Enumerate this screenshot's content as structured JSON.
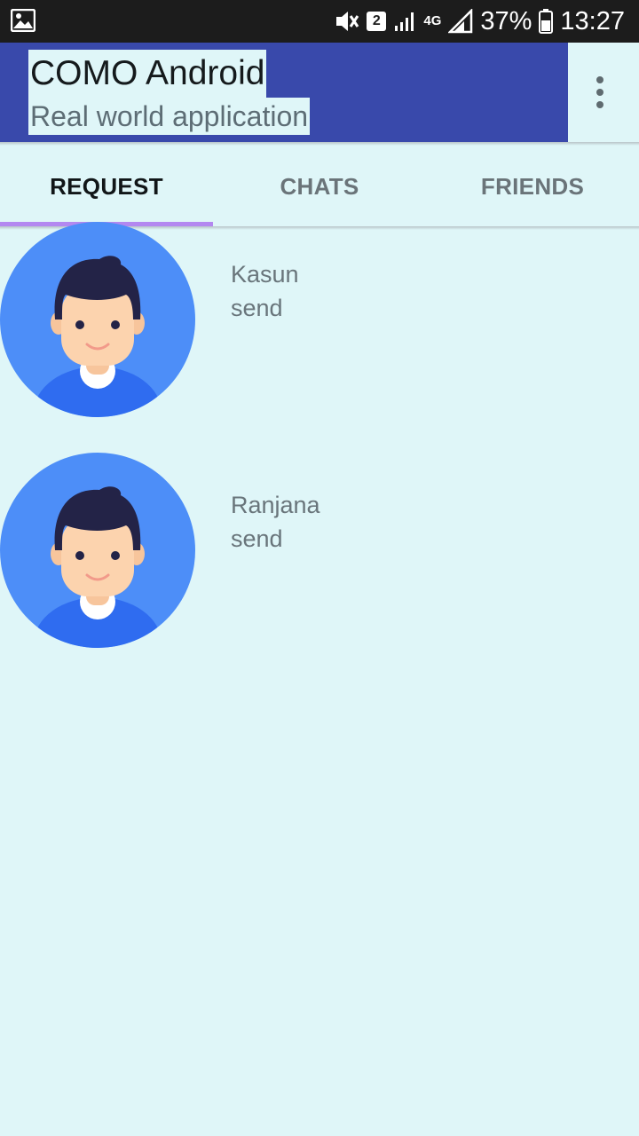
{
  "status_bar": {
    "icons": [
      "gallery-icon",
      "vibrate-icon",
      "sim-icon",
      "signal-icon",
      "network-4g-icon",
      "signal-icon",
      "battery-icon"
    ],
    "sim_slot": "2",
    "network": "4G",
    "battery": "37%",
    "time": "13:27"
  },
  "app_bar": {
    "title": "COMO Android",
    "subtitle": "Real world application",
    "colors": {
      "primary": "#3949ab",
      "background": "#dff6f8"
    },
    "overflow_icon": "more-vert-icon"
  },
  "tabs": [
    {
      "label": "REQUEST",
      "active": true
    },
    {
      "label": "CHATS",
      "active": false
    },
    {
      "label": "FRIENDS",
      "active": false
    }
  ],
  "tab_indicator_color": "#b388f0",
  "requests": [
    {
      "name": "Kasun",
      "status": "send",
      "avatar": "user-avatar-icon"
    },
    {
      "name": "Ranjana",
      "status": "send",
      "avatar": "user-avatar-icon"
    }
  ]
}
